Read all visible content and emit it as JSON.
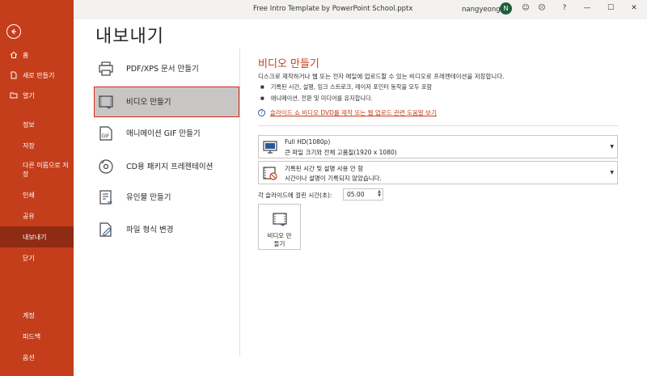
{
  "titlebar": {
    "file_title": "Free Intro Template by PowerPoint School.pptx",
    "user_name": "nangyeong",
    "avatar_initial": "N",
    "smile": "☺",
    "frown": "☹",
    "help": "?",
    "minimize": "—",
    "maximize": "☐",
    "close": "✕"
  },
  "sidebar": {
    "top_items": [
      {
        "label": "홈",
        "icon": "home-icon"
      },
      {
        "label": "새로 만들기",
        "icon": "new-file-icon"
      },
      {
        "label": "열기",
        "icon": "folder-open-icon"
      }
    ],
    "items": [
      {
        "label": "정보"
      },
      {
        "label": "저장"
      },
      {
        "label": "다른 이름으로 저장"
      },
      {
        "label": "인쇄"
      },
      {
        "label": "공유"
      },
      {
        "label": "내보내기",
        "selected": true
      },
      {
        "label": "닫기"
      }
    ],
    "bottom_items": [
      {
        "label": "계정"
      },
      {
        "label": "피드백"
      },
      {
        "label": "옵션"
      }
    ]
  },
  "page": {
    "heading": "내보내기"
  },
  "export_options": [
    {
      "label": "PDF/XPS 문서 만들기",
      "icon": "pdf-document-icon"
    },
    {
      "label": "비디오 만들기",
      "icon": "video-icon",
      "selected": true
    },
    {
      "label": "애니메이션 GIF 만들기",
      "icon": "gif-icon"
    },
    {
      "label": "CD용 패키지 프레젠테이션",
      "icon": "cd-icon"
    },
    {
      "label": "유인물 만들기",
      "icon": "handout-icon"
    },
    {
      "label": "파일 형식 변경",
      "icon": "change-file-type-icon"
    }
  ],
  "video_panel": {
    "title": "비디오 만들기",
    "description": "디스크로 제작하거나 웹 또는 전자 메일에 업로드할 수 있는 비디오로 프레젠테이션을 저장합니다.",
    "bullets": [
      "기록된 시간, 설명, 잉크 스트로크, 레이저 포인터 동작을 모두 포함",
      "애니메이션, 전환 및 미디어를 유지합니다."
    ],
    "help_link": "슬라이드 쇼 비디오 DVD를 제작 또는 웹 업로드 관련 도움말 보기",
    "quality": {
      "line1": "Full HD(1080p)",
      "line2": "큰 파일 크기와 전체 고품질(1920 x 1080)"
    },
    "narration": {
      "line1": "기록된 시간 및 설명 사용 안 함",
      "line2": "시간이나 설명이 기록되지 않았습니다."
    },
    "time_label": "각 슬라이드에 걸린 시간(초):",
    "time_value": "05.00",
    "make_button": "비디오 만들기"
  }
}
